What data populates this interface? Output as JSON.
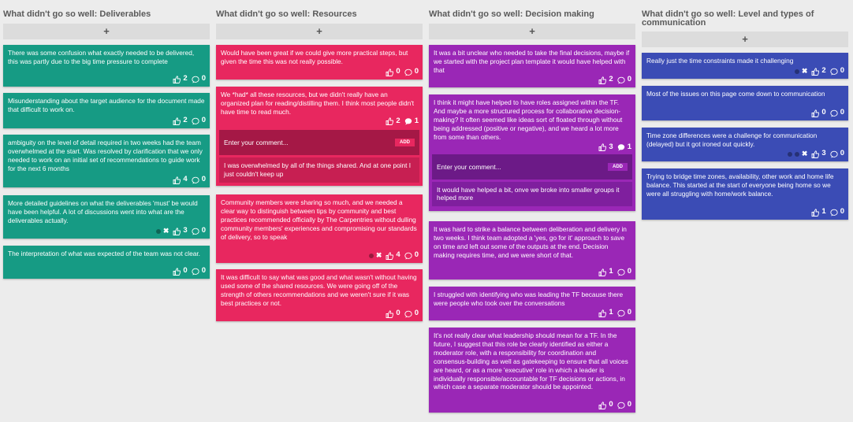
{
  "add_label": "+",
  "comment_placeholder": "Enter your comment...",
  "comment_add_label": "ADD",
  "columns": [
    {
      "title": "What didn't go so well: Deliverables",
      "cards": [
        {
          "text": "There was some confusion what exactly needed to be delivered, this was partly due to the big time pressure to complete",
          "votes": "2",
          "comments": "0"
        },
        {
          "text": "Misunderstanding about the target audience for the document made that difficult to work on.",
          "votes": "2",
          "comments": "0"
        },
        {
          "text": "ambiguity on the level of detail required in two weeks had the team overwhelmed at the start. Was resolved by clarification that we only needed to work on an initial set of recommendations to guide work for the next 6 months",
          "votes": "4",
          "comments": "0"
        },
        {
          "text": "More detailed guidelines on what the deliverables 'must' be would have been helpful. A lot of discussions went into what are the deliverables actually.",
          "votes": "3",
          "comments": "0"
        },
        {
          "text": "The interpretation of what was expected of the team was not clear.",
          "votes": "0",
          "comments": "0"
        }
      ]
    },
    {
      "title": "What didn't go so well: Resources",
      "cards": [
        {
          "text": "Would have been great if we could give more practical steps, but given the time this was not really possible.",
          "votes": "0",
          "comments": "0"
        },
        {
          "text": "We *had* all these resources, but we didn't really have an organized plan for reading/distilling them. I think most people didn't have time to read much.",
          "votes": "2",
          "comments": "1",
          "reply": "I was overwhelmed by all of the things shared. And at one point I just couldn't keep up"
        },
        {
          "text": "Community members were sharing so much, and we needed a clear way to distinguish between tips by community and best practices recommended officially by The Carpentries without dulling community members' experiences and compromising our standards of delivery, so to speak",
          "votes": "4",
          "comments": "0"
        },
        {
          "text": "It was difficult to say what was good and what wasn't without having used some of the shared resources. We were going off of the strength of others recommendations and we weren't sure if it was best practices or not.",
          "votes": "0",
          "comments": "0"
        }
      ]
    },
    {
      "title": "What didn't go so well: Decision making",
      "cards": [
        {
          "text": "It was a bit unclear who needed to take the final decisions, maybe if we started with the project plan template it would have helped with that",
          "votes": "2",
          "comments": "0"
        },
        {
          "text": "I think it might have helped to have roles assigned within the TF. And maybe a more structured process for collaborative decision-making? It often seemed like ideas sort of floated through without being addressed (positive or negative), and we heard a lot more from some than others.",
          "votes": "3",
          "comments": "1",
          "reply": "It would have helped a bit, onve we broke into smaller groups it helped more"
        },
        {
          "text": "It was hard to strike a balance between deliberation and delivery in two weeks. I think team adopted a 'yes, go for it' approach to save on time and left out some of the outputs at the end. Decision making requires time, and we were short of that.",
          "votes": "1",
          "comments": "0"
        },
        {
          "text": "I struggled with identifying who was leading the TF because there were people who took over the conversations",
          "votes": "1",
          "comments": "0"
        },
        {
          "text": "It's not really clear what leadership should mean for a TF. In the future, I suggest that this role be clearly identified as either a moderator role, with a responsibility for coordination and consensus-building as well as gatekeeping to ensure that all voices are heard, or as a more 'executive' role in which a leader is individually responsible/accountable for TF decisions or actions, in which case a separate moderator should be appointed.",
          "votes": "0",
          "comments": "0"
        }
      ]
    },
    {
      "title": "What didn't go so well: Level and types of communication",
      "cards": [
        {
          "text": "Really just the time constraints made it challenging",
          "votes": "2",
          "comments": "0"
        },
        {
          "text": "Most of the issues on this page come down to communication",
          "votes": "0",
          "comments": "0"
        },
        {
          "text": "Time zone differences were a challenge for communication (delayed) but it got ironed out quickly.",
          "votes": "3",
          "comments": "0"
        },
        {
          "text": "Trying to bridge time zones, availability, other work and home life balance. This started at the start of everyone being home so we were all struggling with home/work balance.",
          "votes": "1",
          "comments": "0"
        }
      ]
    }
  ],
  "colors": {
    "deliverables": "#169b84",
    "resources": "#e8275f",
    "decision_making": "#9a27b6",
    "communication": "#3b4cb5",
    "background": "#ececec"
  },
  "icons": {
    "vote": "thumbs-up-icon",
    "comment": "speech-bubble-icon",
    "delete": "close-icon",
    "drag": "dot-handle-icon"
  }
}
